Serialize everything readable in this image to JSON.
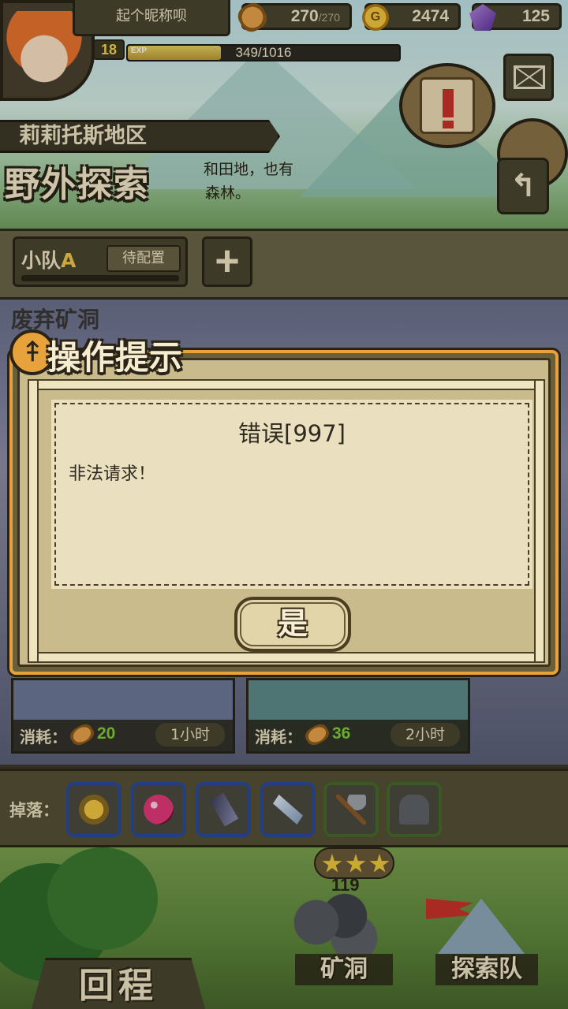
{
  "player": {
    "nickname": "起个昵称呗",
    "level": "18",
    "exp_tag": "EXP",
    "exp_text": "349/1016",
    "exp_fraction": 0.343
  },
  "resources": {
    "stamina": {
      "value": "270",
      "max": "/270",
      "icon": "bread-icon"
    },
    "gold": {
      "value": "2474",
      "icon": "gold-coin-icon",
      "glyph": "G"
    },
    "gems": {
      "value": "125",
      "icon": "purple-gem-icon"
    }
  },
  "region": {
    "name": "莉莉托斯地区",
    "title": "野外探索",
    "description_line1": "和田地，也有",
    "description_line2": "森林。"
  },
  "team": {
    "label_prefix": "小队",
    "label_letter": "A",
    "status": "待配置",
    "add_glyph": "+"
  },
  "location": {
    "name": "废弃矿洞"
  },
  "dialog": {
    "header": "操作提示",
    "header_icon_glyph": "⤉",
    "error_title": "错误[997]",
    "error_message": "非法请求！",
    "confirm_label": "是"
  },
  "costs": [
    {
      "label": "消耗：",
      "value": "20",
      "time": "1小时"
    },
    {
      "label": "消耗：",
      "value": "36",
      "time": "2小时"
    }
  ],
  "drops": {
    "label": "掉落：",
    "items": [
      "gold-ore-icon",
      "red-orb-icon",
      "iron-bar-icon",
      "crystal-shard-icon",
      "pickaxe-icon",
      "helmet-icon"
    ]
  },
  "bottom": {
    "return_label": "回程",
    "mine_label": "矿洞",
    "mine_count": "119",
    "team_label": "探索队"
  },
  "colors": {
    "accent_orange": "#e7a23b",
    "panel_brown": "#4a4530",
    "paper": "#eae0c0",
    "cost_green": "#7ecb3c"
  },
  "icons": {
    "back": "↰",
    "mail": "envelope-icon",
    "quest": "quest-scroll-icon",
    "bag": "backpack-icon"
  }
}
